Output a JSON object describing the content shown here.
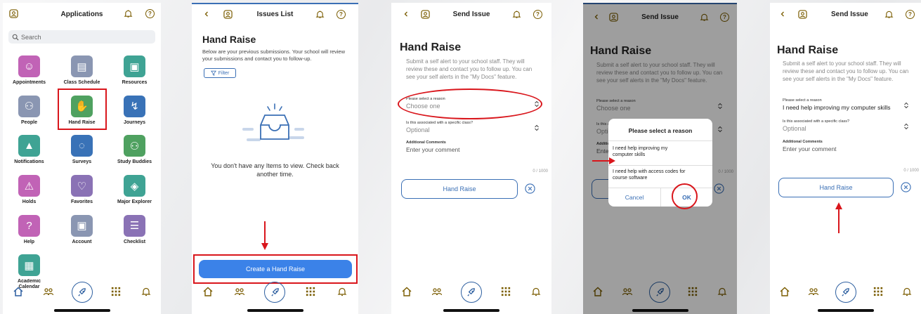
{
  "screen1": {
    "title": "Applications",
    "search_placeholder": "Search",
    "tiles": [
      {
        "label": "Appointments",
        "color": "#c163b6",
        "icon": "person-icon"
      },
      {
        "label": "Class Schedule",
        "color": "#8a96b2",
        "icon": "schedule-icon"
      },
      {
        "label": "Resources",
        "color": "#3fa394",
        "icon": "resources-icon"
      },
      {
        "label": "People",
        "color": "#8a96b2",
        "icon": "people-icon"
      },
      {
        "label": "Hand Raise",
        "color": "#4fa160",
        "icon": "hand-raise-icon"
      },
      {
        "label": "Journeys",
        "color": "#3972b7",
        "icon": "journeys-icon"
      },
      {
        "label": "Notifications",
        "color": "#3fa394",
        "icon": "bell-icon"
      },
      {
        "label": "Surveys",
        "color": "#3972b7",
        "icon": "chat-icon"
      },
      {
        "label": "Study Buddies",
        "color": "#4fa160",
        "icon": "study-buddies-icon"
      },
      {
        "label": "Holds",
        "color": "#c163b6",
        "icon": "warning-icon"
      },
      {
        "label": "Favorites",
        "color": "#8a72b5",
        "icon": "heart-icon"
      },
      {
        "label": "Major Explorer",
        "color": "#3fa394",
        "icon": "graduation-icon"
      },
      {
        "label": "Help",
        "color": "#c163b6",
        "icon": "help-icon"
      },
      {
        "label": "Account",
        "color": "#8a96b2",
        "icon": "account-icon"
      },
      {
        "label": "Checklist",
        "color": "#8a72b5",
        "icon": "checklist-icon"
      },
      {
        "label": "Academic Calendar",
        "color": "#3fa394",
        "icon": "calendar-icon"
      }
    ]
  },
  "screen2": {
    "title": "Issues List",
    "heading": "Hand Raise",
    "description": "Below are your previous submissions. Your school will review your submissions and contact you to follow-up.",
    "filter_label": "Filter",
    "empty_text": "You don't have any Items to view. Check back another time.",
    "create_button": "Create a Hand Raise"
  },
  "send_issue": {
    "title": "Send Issue",
    "heading": "Hand Raise",
    "description": "Submit a self alert to your school staff. They will review these and contact you to follow up. You can see your self alerts in the \"My Docs\" feature.",
    "reason_label": "Please select a reason",
    "reason_placeholder": "Choose one",
    "class_label": "Is this associated with a specific class?",
    "class_placeholder": "Optional",
    "comments_label": "Additional Comments",
    "comments_placeholder": "Enter your comment",
    "char_count": "0 / 1000",
    "submit_button": "Hand Raise"
  },
  "dialog": {
    "title": "Please select a reason",
    "option1": "I need help improving my computer skills",
    "option2": "I need help with access codes for course software",
    "cancel": "Cancel",
    "ok": "OK"
  },
  "screen5": {
    "selected_reason": "I need help improving my computer skills"
  },
  "colors": {
    "accent": "#2d5fa0",
    "button_blue": "#3b82e8",
    "highlight_red": "#d9161c",
    "icon_gold": "#7a5c00"
  }
}
